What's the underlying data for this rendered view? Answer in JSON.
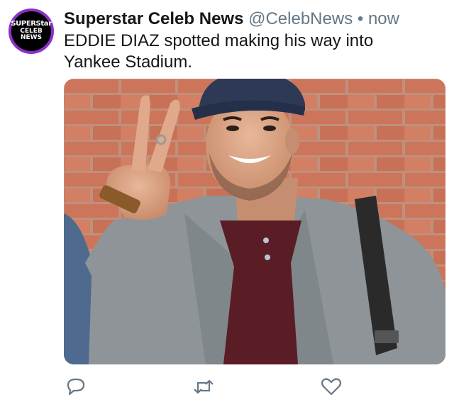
{
  "tweet": {
    "avatar": {
      "line1": "SUPERStar",
      "line2": "CELEB",
      "line3": "NEWS"
    },
    "display_name": "Superstar Celeb News",
    "handle": "@CelebNews",
    "separator": "•",
    "timestamp": "now",
    "text": "EDDIE DIAZ spotted making his way into Yankee Stadium."
  },
  "actions": {
    "icons": [
      "reply-icon",
      "retweet-icon",
      "like-icon"
    ]
  },
  "colors": {
    "avatar_ring": "#8b2fc9",
    "secondary_text": "#657786",
    "icon": "#657786"
  }
}
